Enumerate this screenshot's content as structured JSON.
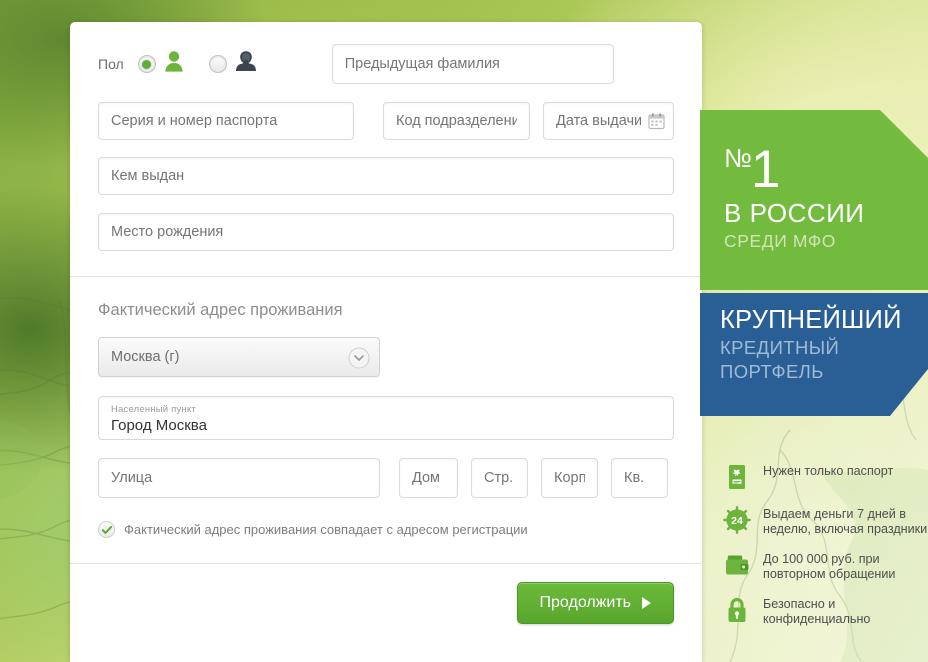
{
  "form": {
    "gender": {
      "label": "Пол",
      "male_selected": true,
      "female_selected": false,
      "male_icon": "male-person-icon",
      "female_icon": "female-person-icon"
    },
    "fields": {
      "prev_surname": {
        "placeholder": "Предыдущая фамилия",
        "value": ""
      },
      "passport_series": {
        "placeholder": "Серия и номер паспорта",
        "value": ""
      },
      "department_code": {
        "placeholder": "Код подразделения",
        "value": ""
      },
      "issue_date": {
        "placeholder": "Дата выдачи",
        "value": "",
        "icon": "calendar-icon"
      },
      "issued_by": {
        "placeholder": "Кем выдан",
        "value": ""
      },
      "birth_place": {
        "placeholder": "Место рождения",
        "value": ""
      }
    },
    "address": {
      "title": "Фактический адрес проживания",
      "region_select": {
        "value": "Москва (г)",
        "icon": "chevron-down-icon"
      },
      "locality": {
        "label": "Населенный пункт",
        "value": "Город Москва"
      },
      "street": {
        "placeholder": "Улица",
        "value": ""
      },
      "house": {
        "placeholder": "Дом",
        "value": ""
      },
      "building": {
        "placeholder": "Стр.",
        "value": ""
      },
      "block": {
        "placeholder": "Корп.",
        "value": ""
      },
      "apartment": {
        "placeholder": "Кв.",
        "value": ""
      }
    },
    "same_address_checkbox": {
      "label": "Фактический адрес проживания совпадает с адресом регистрации",
      "checked": true,
      "icon": "check-icon"
    },
    "submit": {
      "label": "Продолжить",
      "icon": "play-arrow-icon"
    }
  },
  "banner": {
    "green": {
      "number_symbol": "№",
      "number": "1",
      "line2": "В РОССИИ",
      "line3": "СРЕДИ МФО",
      "color": "#72bb3f"
    },
    "blue": {
      "line1": "КРУПНЕЙШИЙ",
      "line2": "КРЕДИТНЫЙ",
      "line3": "ПОРТФЕЛЬ",
      "color": "#2a5f95"
    }
  },
  "features": [
    {
      "icon": "passport-icon",
      "text": "Нужен только паспорт"
    },
    {
      "icon": "24-hours-icon",
      "text": "Выдаем деньги 7 дней в неделю, включая праздники"
    },
    {
      "icon": "wallet-icon",
      "text": "До 100 000 руб. при повторном обращении"
    },
    {
      "icon": "lock-icon",
      "text": "Безопасно и конфиденциально"
    }
  ],
  "colors": {
    "accent_green": "#5cb031",
    "button_green": "#6cbb3c",
    "banner_blue": "#2a5f95"
  }
}
